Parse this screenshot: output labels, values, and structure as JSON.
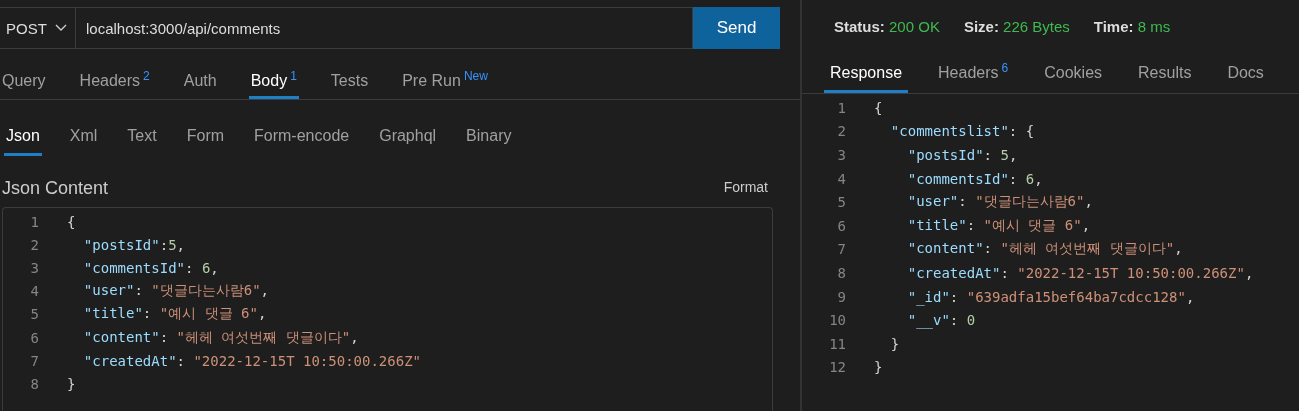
{
  "request": {
    "method": "POST",
    "url": "localhost:3000/api/comments",
    "send": "Send"
  },
  "request_tabs": [
    {
      "label": "Query",
      "selected": false
    },
    {
      "label": "Headers",
      "count": "2",
      "selected": false
    },
    {
      "label": "Auth",
      "selected": false
    },
    {
      "label": "Body",
      "count": "1",
      "selected": true
    },
    {
      "label": "Tests",
      "selected": false
    },
    {
      "label": "Pre Run",
      "count": "New",
      "selected": false
    }
  ],
  "body_tabs": [
    {
      "label": "Json",
      "selected": true
    },
    {
      "label": "Xml",
      "selected": false
    },
    {
      "label": "Text",
      "selected": false
    },
    {
      "label": "Form",
      "selected": false
    },
    {
      "label": "Form-encode",
      "selected": false
    },
    {
      "label": "Graphql",
      "selected": false
    },
    {
      "label": "Binary",
      "selected": false
    }
  ],
  "editor": {
    "title": "Json Content",
    "format": "Format",
    "lines": [
      {
        "number": "1",
        "tokens": [
          {
            "kind": "punct",
            "text": "{"
          }
        ]
      },
      {
        "number": "2",
        "tokens": [
          {
            "kind": "key",
            "text": "  \"postsId\""
          },
          {
            "kind": "punct",
            "text": ":"
          },
          {
            "kind": "number",
            "text": "5"
          },
          {
            "kind": "punct",
            "text": ","
          }
        ]
      },
      {
        "number": "3",
        "tokens": [
          {
            "kind": "key",
            "text": "  \"commentsId\""
          },
          {
            "kind": "punct",
            "text": ": "
          },
          {
            "kind": "number",
            "text": "6"
          },
          {
            "kind": "punct",
            "text": ","
          }
        ]
      },
      {
        "number": "4",
        "tokens": [
          {
            "kind": "key",
            "text": "  \"user\""
          },
          {
            "kind": "punct",
            "text": ": "
          },
          {
            "kind": "string",
            "text": "\"댓글다는사람6\""
          },
          {
            "kind": "punct",
            "text": ","
          }
        ]
      },
      {
        "number": "5",
        "tokens": [
          {
            "kind": "key",
            "text": "  \"title\""
          },
          {
            "kind": "punct",
            "text": ": "
          },
          {
            "kind": "string",
            "text": "\"예시 댓글 6\""
          },
          {
            "kind": "punct",
            "text": ","
          }
        ]
      },
      {
        "number": "6",
        "tokens": [
          {
            "kind": "key",
            "text": "  \"content\""
          },
          {
            "kind": "punct",
            "text": ": "
          },
          {
            "kind": "string",
            "text": "\"헤헤 여섯번째 댓글이다\""
          },
          {
            "kind": "punct",
            "text": ","
          }
        ]
      },
      {
        "number": "7",
        "tokens": [
          {
            "kind": "key",
            "text": "  \"createdAt\""
          },
          {
            "kind": "punct",
            "text": ": "
          },
          {
            "kind": "string",
            "text": "\"2022-12-15T 10:50:00.266Z\""
          }
        ]
      },
      {
        "number": "8",
        "tokens": [
          {
            "kind": "punct",
            "text": "}"
          }
        ]
      }
    ]
  },
  "status": [
    {
      "label": "Status:",
      "value": "200 OK"
    },
    {
      "label": "Size:",
      "value": "226 Bytes"
    },
    {
      "label": "Time:",
      "value": "8 ms"
    }
  ],
  "response_tabs": [
    {
      "label": "Response",
      "selected": true
    },
    {
      "label": "Headers",
      "count": "6",
      "selected": false
    },
    {
      "label": "Cookies",
      "selected": false
    },
    {
      "label": "Results",
      "selected": false
    },
    {
      "label": "Docs",
      "selected": false
    }
  ],
  "response": {
    "lines": [
      {
        "number": "1",
        "tokens": [
          {
            "kind": "punct",
            "text": "{"
          }
        ]
      },
      {
        "number": "2",
        "tokens": [
          {
            "kind": "key",
            "text": "  \"commentslist\""
          },
          {
            "kind": "punct",
            "text": ": {"
          }
        ]
      },
      {
        "number": "3",
        "tokens": [
          {
            "kind": "key",
            "text": "    \"postsId\""
          },
          {
            "kind": "punct",
            "text": ": "
          },
          {
            "kind": "number",
            "text": "5"
          },
          {
            "kind": "punct",
            "text": ","
          }
        ]
      },
      {
        "number": "4",
        "tokens": [
          {
            "kind": "key",
            "text": "    \"commentsId\""
          },
          {
            "kind": "punct",
            "text": ": "
          },
          {
            "kind": "number",
            "text": "6"
          },
          {
            "kind": "punct",
            "text": ","
          }
        ]
      },
      {
        "number": "5",
        "tokens": [
          {
            "kind": "key",
            "text": "    \"user\""
          },
          {
            "kind": "punct",
            "text": ": "
          },
          {
            "kind": "string",
            "text": "\"댓글다는사람6\""
          },
          {
            "kind": "punct",
            "text": ","
          }
        ]
      },
      {
        "number": "6",
        "tokens": [
          {
            "kind": "key",
            "text": "    \"title\""
          },
          {
            "kind": "punct",
            "text": ": "
          },
          {
            "kind": "string",
            "text": "\"예시 댓글 6\""
          },
          {
            "kind": "punct",
            "text": ","
          }
        ]
      },
      {
        "number": "7",
        "tokens": [
          {
            "kind": "key",
            "text": "    \"content\""
          },
          {
            "kind": "punct",
            "text": ": "
          },
          {
            "kind": "string",
            "text": "\"헤헤 여섯번째 댓글이다\""
          },
          {
            "kind": "punct",
            "text": ","
          }
        ]
      },
      {
        "number": "8",
        "tokens": [
          {
            "kind": "key",
            "text": "    \"createdAt\""
          },
          {
            "kind": "punct",
            "text": ": "
          },
          {
            "kind": "string",
            "text": "\"2022-12-15T 10:50:00.266Z\""
          },
          {
            "kind": "punct",
            "text": ","
          }
        ]
      },
      {
        "number": "9",
        "tokens": [
          {
            "kind": "key",
            "text": "    \"_id\""
          },
          {
            "kind": "punct",
            "text": ": "
          },
          {
            "kind": "string",
            "text": "\"639adfa15bef64ba7cdcc128\""
          },
          {
            "kind": "punct",
            "text": ","
          }
        ]
      },
      {
        "number": "10",
        "tokens": [
          {
            "kind": "key",
            "text": "    \"__v\""
          },
          {
            "kind": "punct",
            "text": ": "
          },
          {
            "kind": "number",
            "text": "0"
          }
        ]
      },
      {
        "number": "11",
        "tokens": [
          {
            "kind": "punct",
            "text": "  }"
          }
        ]
      },
      {
        "number": "12",
        "tokens": [
          {
            "kind": "punct",
            "text": "}"
          }
        ]
      }
    ]
  }
}
